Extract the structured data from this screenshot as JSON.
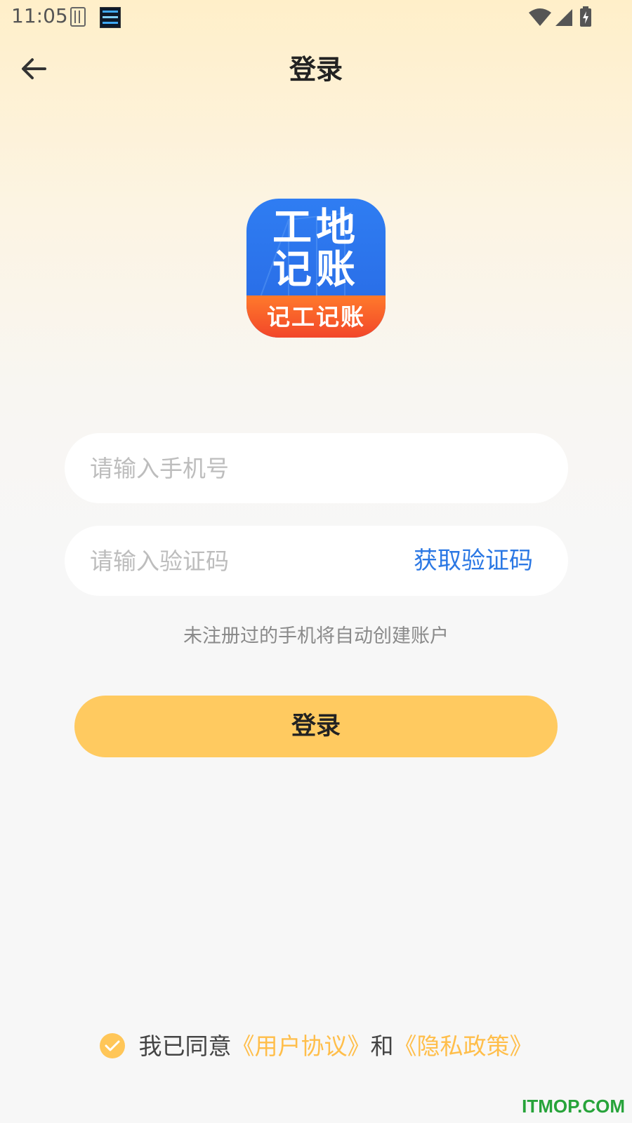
{
  "status_bar": {
    "time": "11:05"
  },
  "header": {
    "title": "登录",
    "back_icon": "arrow-left-icon"
  },
  "logo": {
    "line1": "工地",
    "line2": "记账",
    "band_text": "记工记账"
  },
  "form": {
    "phone_placeholder": "请输入手机号",
    "phone_value": "",
    "code_placeholder": "请输入验证码",
    "code_value": "",
    "get_code_label": "获取验证码",
    "hint": "未注册过的手机将自动创建账户",
    "login_label": "登录"
  },
  "agreement": {
    "checked": true,
    "prefix": "我已同意",
    "user_agreement": "《用户协议》",
    "and": "和",
    "privacy_policy": "《隐私政策》"
  },
  "watermark": "ITMOP.COM",
  "colors": {
    "accent": "#FFCA60",
    "link": "#FFBE4A",
    "code_link": "#2B78E4"
  }
}
